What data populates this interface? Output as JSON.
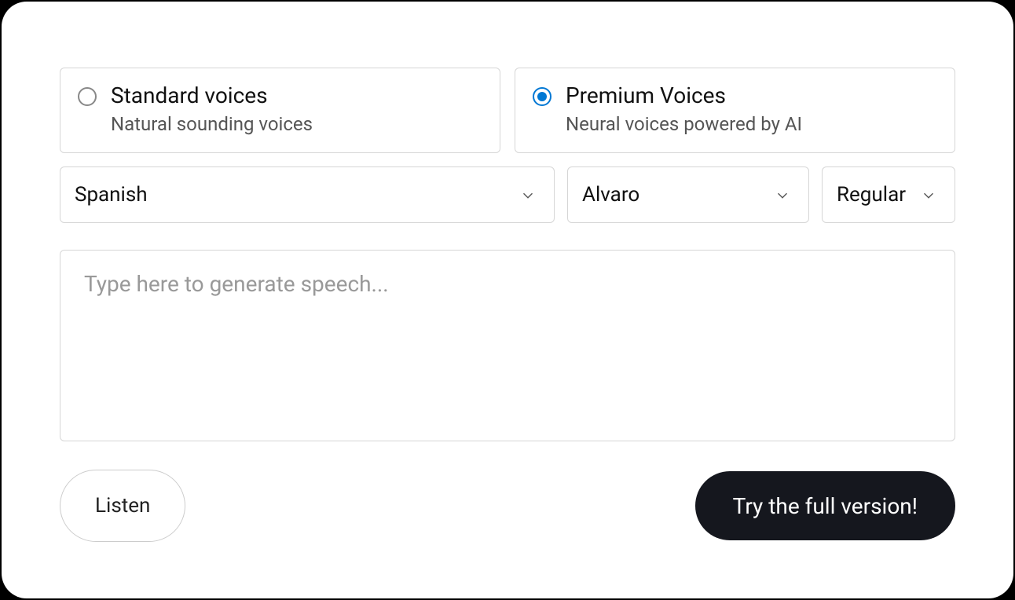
{
  "voiceTypes": {
    "standard": {
      "title": "Standard voices",
      "subtitle": "Natural sounding voices",
      "selected": false
    },
    "premium": {
      "title": "Premium Voices",
      "subtitle": "Neural voices powered by AI",
      "selected": true
    }
  },
  "selects": {
    "language": "Spanish",
    "voice": "Alvaro",
    "speed": "Regular"
  },
  "textarea": {
    "value": "",
    "placeholder": "Type here to generate speech..."
  },
  "buttons": {
    "listen": "Listen",
    "tryFull": "Try the full version!"
  }
}
